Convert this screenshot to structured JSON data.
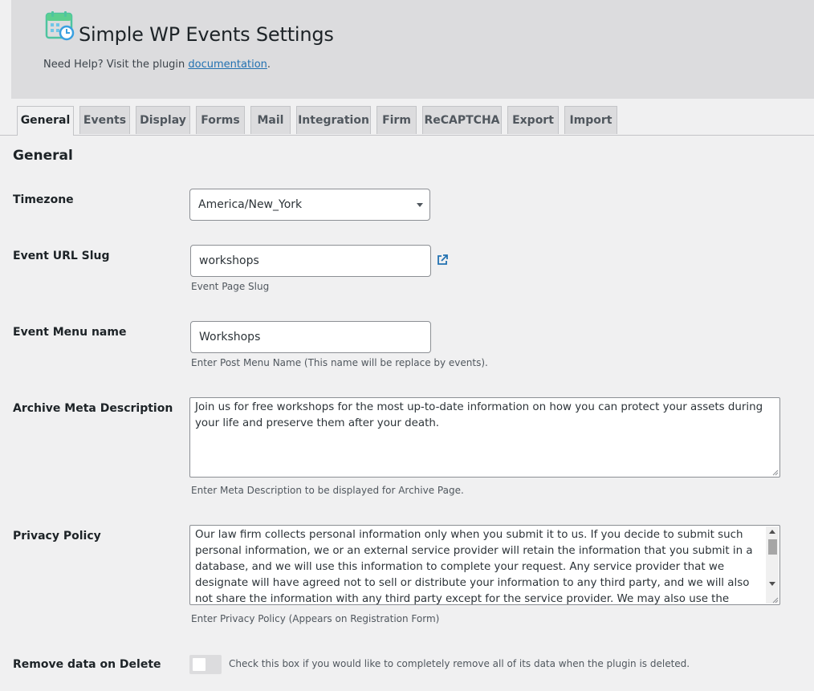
{
  "header": {
    "title": "Simple WP Events Settings",
    "help_prefix": "Need Help? Visit the plugin ",
    "help_link": "documentation",
    "help_suffix": "."
  },
  "tabs": [
    {
      "label": "General",
      "active": true
    },
    {
      "label": "Events"
    },
    {
      "label": "Display"
    },
    {
      "label": "Forms"
    },
    {
      "label": "Mail"
    },
    {
      "label": "Integration"
    },
    {
      "label": "Firm"
    },
    {
      "label": "ReCAPTCHA"
    },
    {
      "label": "Export"
    },
    {
      "label": "Import"
    }
  ],
  "section_title": "General",
  "fields": {
    "timezone": {
      "label": "Timezone",
      "value": "America/New_York"
    },
    "slug": {
      "label": "Event URL Slug",
      "value": "workshops",
      "desc": "Event Page Slug"
    },
    "menu_name": {
      "label": "Event Menu name",
      "value": "Workshops",
      "desc": "Enter Post Menu Name (This name will be replace by events)."
    },
    "archive_meta": {
      "label": "Archive Meta Description",
      "value": "Join us for free workshops for the most up-to-date information on how you can protect your assets during your life and preserve them after your death.",
      "desc": "Enter Meta Description to be displayed for Archive Page."
    },
    "privacy": {
      "label": "Privacy Policy",
      "value": "Our law firm collects personal information only when you submit it to us. If you decide to submit such personal information, we or an external service provider will retain the information that you submit in a database, and we will use this information to complete your request. Any service provider that we designate will have agreed not to sell or distribute your information to any third party, and we will also not share the information with any third party except for the service provider. We may also use the information retained in the database to communicate",
      "desc": "Enter Privacy Policy (Appears on Registration Form)"
    },
    "remove_data": {
      "label": "Remove data on Delete",
      "desc": "Check this box if you would like to completely remove all of its data when the plugin is deleted.",
      "checked": false
    }
  },
  "colors": {
    "accent": "#2271b1",
    "logo_green": "#5ccf8f",
    "logo_blue": "#3aa0e0"
  }
}
